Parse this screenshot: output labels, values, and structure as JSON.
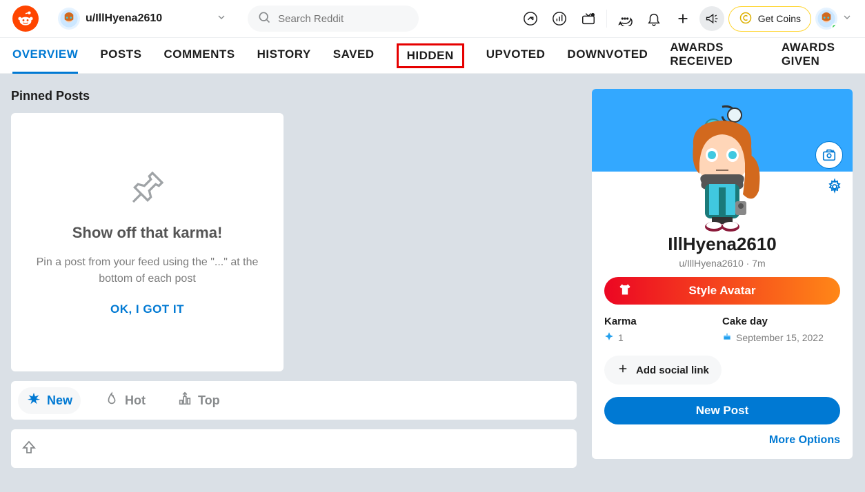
{
  "header": {
    "username_dropdown": "u/IllHyena2610",
    "search_placeholder": "Search Reddit",
    "coins_label": "Get Coins"
  },
  "tabs": [
    {
      "label": "OVERVIEW",
      "active": true
    },
    {
      "label": "POSTS"
    },
    {
      "label": "COMMENTS"
    },
    {
      "label": "HISTORY"
    },
    {
      "label": "SAVED"
    },
    {
      "label": "HIDDEN",
      "highlight": true
    },
    {
      "label": "UPVOTED"
    },
    {
      "label": "DOWNVOTED"
    },
    {
      "label": "AWARDS RECEIVED"
    },
    {
      "label": "AWARDS GIVEN"
    }
  ],
  "pinned": {
    "section_title": "Pinned Posts",
    "heading": "Show off that karma!",
    "description": "Pin a post from your feed using the \"...\" at the bottom of each post",
    "ok_label": "OK, I GOT IT"
  },
  "sort": {
    "new": "New",
    "hot": "Hot",
    "top": "Top"
  },
  "profile": {
    "display_name": "IllHyena2610",
    "sub_line": "u/IllHyena2610 · 7m",
    "style_avatar_label": "Style Avatar",
    "karma_label": "Karma",
    "karma_value": "1",
    "cakeday_label": "Cake day",
    "cakeday_value": "September 15, 2022",
    "add_social_label": "Add social link",
    "new_post_label": "New Post",
    "more_options_label": "More Options"
  }
}
